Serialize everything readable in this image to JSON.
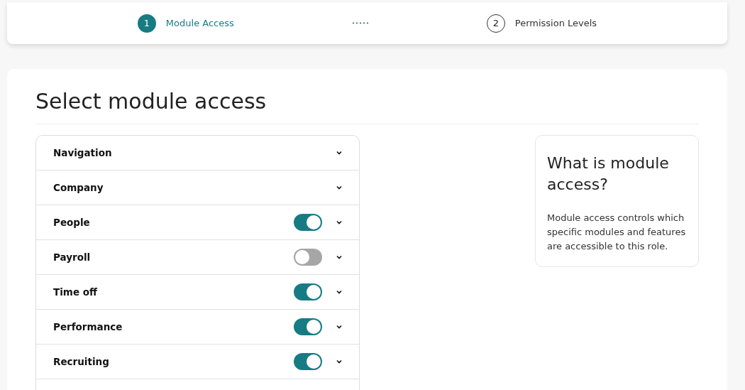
{
  "stepper": {
    "steps": [
      {
        "number": "1",
        "label": "Module Access",
        "selected": true
      },
      {
        "number": "2",
        "label": "Permission Levels",
        "selected": false
      }
    ]
  },
  "title": "Select module access",
  "modules": [
    {
      "kind": "plain",
      "label": "Navigation"
    },
    {
      "kind": "plain",
      "label": "Company"
    },
    {
      "kind": "toggle",
      "label": "People",
      "on": true
    },
    {
      "kind": "toggle",
      "label": "Payroll",
      "on": false
    },
    {
      "kind": "toggle",
      "label": "Time off",
      "on": true
    },
    {
      "kind": "toggle",
      "label": "Performance",
      "on": true
    },
    {
      "kind": "toggle",
      "label": "Recruiting",
      "on": true
    }
  ],
  "info": {
    "heading": "What is module access?",
    "body": "Module access controls which specific modules and features are accessible to this role."
  }
}
